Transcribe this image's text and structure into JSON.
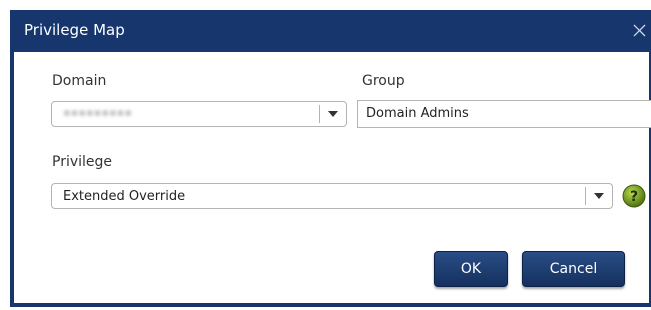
{
  "window": {
    "title": "Privilege Map",
    "close_icon": "close-icon"
  },
  "domain": {
    "label": "Domain",
    "value": "•••••••••"
  },
  "group": {
    "label": "Group",
    "value": "Domain Admins"
  },
  "privilege": {
    "label": "Privilege",
    "value": "Extended Override",
    "help_icon": "help-icon"
  },
  "buttons": {
    "ok_label": "OK",
    "cancel_label": "Cancel"
  },
  "colors": {
    "titlebar": "#16366d",
    "button": "#1c3c72",
    "help_icon": "#6a8e1c"
  }
}
